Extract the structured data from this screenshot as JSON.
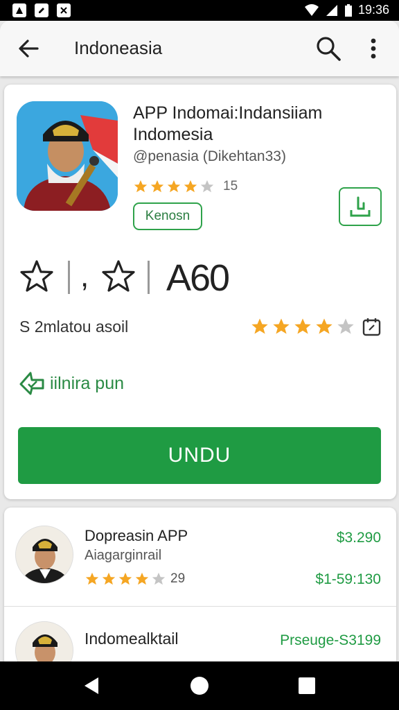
{
  "status": {
    "time": "19:36"
  },
  "appbar": {
    "title": "Indoneasia"
  },
  "app": {
    "title": "APP Indomai:Indansiiam Indomesia",
    "developer": "@penasia (Dikehtan33)",
    "rating_count": "15",
    "rating": 4,
    "tag": "Kenosn"
  },
  "stats": {
    "comma": ",",
    "value": "A60"
  },
  "info_row": {
    "text": "S 2mlatou asoil",
    "rating": 4
  },
  "promo": {
    "text": "iilnira pun"
  },
  "install_button": {
    "label": "UNDU"
  },
  "colors": {
    "accent": "#1f9b43",
    "star": "#f5a623",
    "star_empty": "#c4c4c4"
  },
  "list": [
    {
      "title": "Dopreasin APP",
      "subtitle": "Aiagarginrail",
      "rating": 4,
      "count": "29",
      "price_top": "$3.290",
      "price_bottom": "$1-59:130"
    },
    {
      "title": "Indomealktail",
      "subtitle": "",
      "rating": 0,
      "count": "",
      "price_top": "Prseuge-S3199",
      "price_bottom": ""
    }
  ]
}
